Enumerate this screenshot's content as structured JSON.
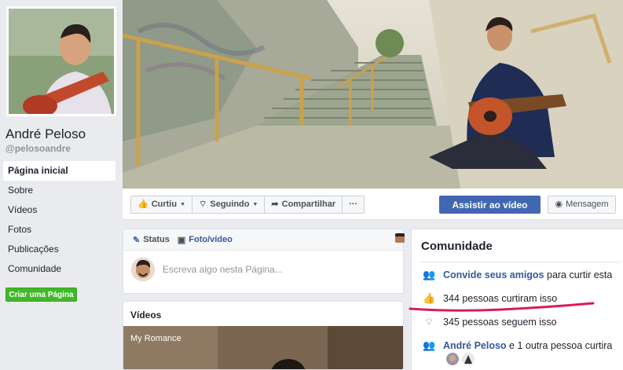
{
  "profile": {
    "name": "André Peloso",
    "handle": "@pelosoandre"
  },
  "sidebar": {
    "items": [
      {
        "label": "Página inicial",
        "active": true
      },
      {
        "label": "Sobre"
      },
      {
        "label": "Vídeos"
      },
      {
        "label": "Fotos"
      },
      {
        "label": "Publicações"
      },
      {
        "label": "Comunidade"
      }
    ],
    "create_label": "Criar uma Página"
  },
  "actions": {
    "like_label": "Curtiu",
    "follow_label": "Seguindo",
    "share_label": "Compartilhar",
    "more_label": "···",
    "watch_label": "Assistir ao vídeo",
    "message_label": "Mensagem"
  },
  "composer": {
    "status_label": "Status",
    "photo_label": "Foto/vídeo",
    "placeholder": "Escreva algo nesta Página..."
  },
  "videos": {
    "title": "Vídeos",
    "first_video_title": "My Romance"
  },
  "community": {
    "title": "Comunidade",
    "invite_link": "Convide seus amigos",
    "invite_rest": " para curtir esta",
    "likes_text": "344 pessoas curtiram isso",
    "follows_text": "345 pessoas seguem isso",
    "friends_link": "André Peloso",
    "friends_rest": " e 1 outra pessoa curtira"
  },
  "colors": {
    "brand_blue": "#4267b2",
    "link_blue": "#365899",
    "green": "#42b72a",
    "annotation_pink": "#d81b60"
  }
}
